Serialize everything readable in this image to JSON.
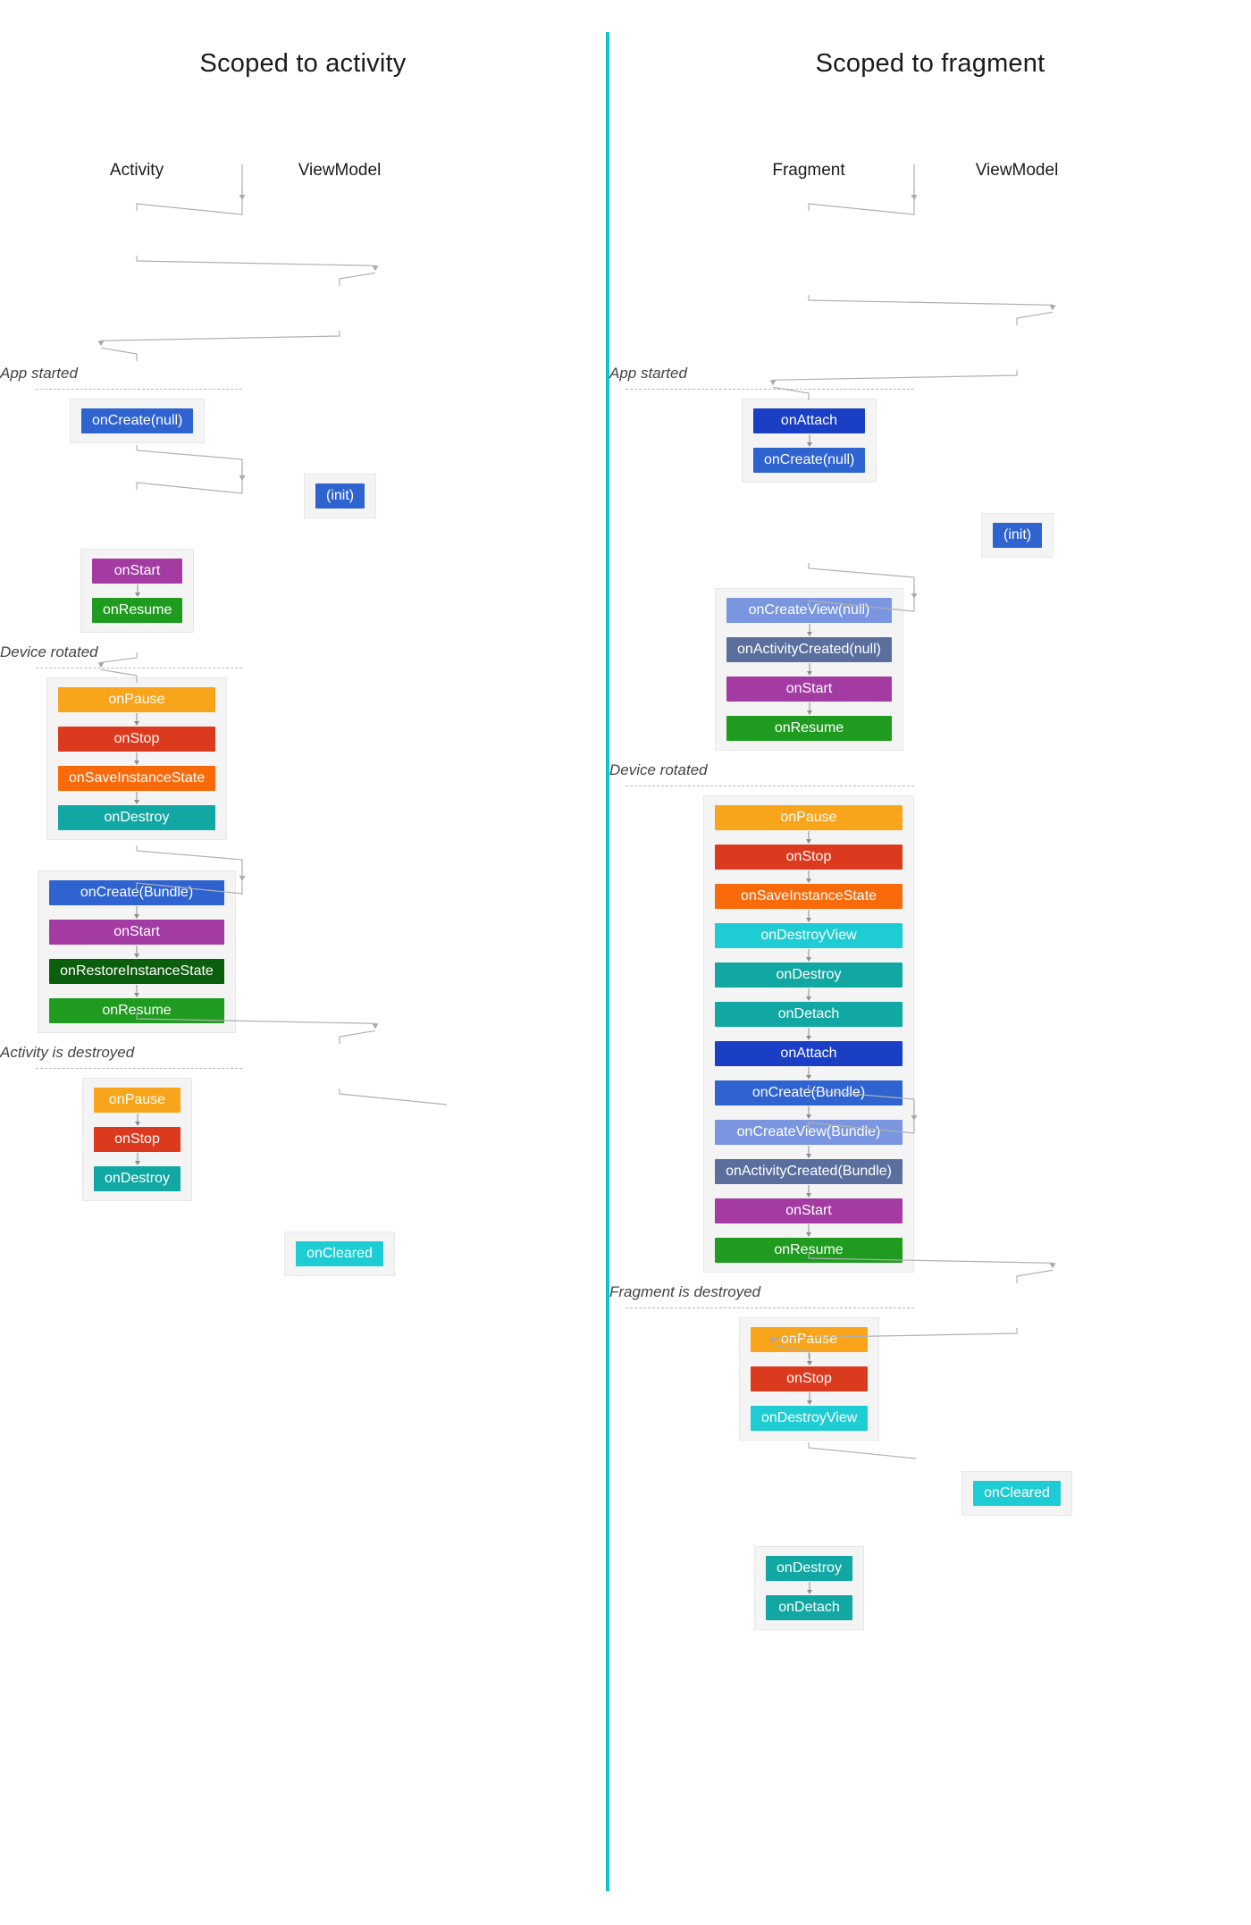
{
  "colors": {
    "divider": "#0bc4cd",
    "blue_dark": "#1b3fc4",
    "blue": "#2f63d0",
    "blue_light": "#7a96e0",
    "slate_blue": "#5a6f9e",
    "purple": "#a33ba3",
    "green": "#1f9c1f",
    "green_dark": "#0b5e0b",
    "orange": "#f9a51b",
    "red": "#dc3a1e",
    "orange_deep": "#f96a0b",
    "teal": "#11a8a4",
    "cyan": "#1ecdd4",
    "group_bg": "#f4f4f4",
    "group_border": "#e7e7e7",
    "connector": "#b0b0b0",
    "event_text": "#444444"
  },
  "columns": [
    {
      "id": "activity",
      "title": "Scoped to activity",
      "lanes": [
        {
          "name": "Activity",
          "x_pct": 22.5
        },
        {
          "name": "ViewModel",
          "x_pct": 56.0
        }
      ],
      "nodes": [
        {
          "kind": "event",
          "label": "App started"
        },
        {
          "kind": "group",
          "lane": "Activity",
          "steps": [
            {
              "label": "onCreate(null)",
              "color": "blue"
            }
          ]
        },
        {
          "kind": "group",
          "lane": "ViewModel",
          "steps": [
            {
              "label": "(init)",
              "color": "blue"
            }
          ]
        },
        {
          "kind": "group",
          "lane": "Activity",
          "steps": [
            {
              "label": "onStart",
              "color": "purple"
            },
            {
              "label": "onResume",
              "color": "green"
            }
          ]
        },
        {
          "kind": "event",
          "label": "Device rotated"
        },
        {
          "kind": "group",
          "lane": "Activity",
          "steps": [
            {
              "label": "onPause",
              "color": "orange"
            },
            {
              "label": "onStop",
              "color": "red"
            },
            {
              "label": "onSaveInstanceState",
              "color": "orange_deep"
            },
            {
              "label": "onDestroy",
              "color": "teal"
            }
          ]
        },
        {
          "kind": "group",
          "lane": "Activity",
          "steps": [
            {
              "label": "onCreate(Bundle)",
              "color": "blue"
            },
            {
              "label": "onStart",
              "color": "purple"
            },
            {
              "label": "onRestoreInstanceState",
              "color": "green_dark"
            },
            {
              "label": "onResume",
              "color": "green"
            }
          ]
        },
        {
          "kind": "event",
          "label": "Activity is destroyed"
        },
        {
          "kind": "group",
          "lane": "Activity",
          "steps": [
            {
              "label": "onPause",
              "color": "orange"
            },
            {
              "label": "onStop",
              "color": "red"
            },
            {
              "label": "onDestroy",
              "color": "teal"
            }
          ]
        },
        {
          "kind": "group",
          "lane": "ViewModel",
          "steps": [
            {
              "label": "onCleared",
              "color": "cyan"
            }
          ]
        }
      ]
    },
    {
      "id": "fragment",
      "title": "Scoped to fragment",
      "lanes": [
        {
          "name": "Fragment",
          "x_pct": 31.0
        },
        {
          "name": "ViewModel",
          "x_pct": 63.5
        }
      ],
      "nodes": [
        {
          "kind": "event",
          "label": "App started"
        },
        {
          "kind": "group",
          "lane": "Fragment",
          "steps": [
            {
              "label": "onAttach",
              "color": "blue_dark"
            },
            {
              "label": "onCreate(null)",
              "color": "blue"
            }
          ]
        },
        {
          "kind": "group",
          "lane": "ViewModel",
          "steps": [
            {
              "label": "(init)",
              "color": "blue"
            }
          ]
        },
        {
          "kind": "group",
          "lane": "Fragment",
          "steps": [
            {
              "label": "onCreateView(null)",
              "color": "blue_light"
            },
            {
              "label": "onActivityCreated(null)",
              "color": "slate_blue"
            },
            {
              "label": "onStart",
              "color": "purple"
            },
            {
              "label": "onResume",
              "color": "green"
            }
          ]
        },
        {
          "kind": "event",
          "label": "Device rotated"
        },
        {
          "kind": "group",
          "lane": "Fragment",
          "steps": [
            {
              "label": "onPause",
              "color": "orange"
            },
            {
              "label": "onStop",
              "color": "red"
            },
            {
              "label": "onSaveInstanceState",
              "color": "orange_deep"
            },
            {
              "label": "onDestroyView",
              "color": "cyan"
            },
            {
              "label": "onDestroy",
              "color": "teal"
            },
            {
              "label": "onDetach",
              "color": "teal"
            },
            {
              "label": "onAttach",
              "color": "blue_dark"
            },
            {
              "label": "onCreate(Bundle)",
              "color": "blue"
            },
            {
              "label": "onCreateView(Bundle)",
              "color": "blue_light"
            },
            {
              "label": "onActivityCreated(Bundle)",
              "color": "slate_blue"
            },
            {
              "label": "onStart",
              "color": "purple"
            },
            {
              "label": "onResume",
              "color": "green"
            }
          ]
        },
        {
          "kind": "event",
          "label": "Fragment is destroyed"
        },
        {
          "kind": "group",
          "lane": "Fragment",
          "steps": [
            {
              "label": "onPause",
              "color": "orange"
            },
            {
              "label": "onStop",
              "color": "red"
            },
            {
              "label": "onDestroyView",
              "color": "cyan"
            }
          ]
        },
        {
          "kind": "group",
          "lane": "ViewModel",
          "steps": [
            {
              "label": "onCleared",
              "color": "cyan"
            }
          ]
        },
        {
          "kind": "group",
          "lane": "Fragment",
          "steps": [
            {
              "label": "onDestroy",
              "color": "teal"
            },
            {
              "label": "onDetach",
              "color": "teal"
            }
          ]
        }
      ]
    }
  ]
}
